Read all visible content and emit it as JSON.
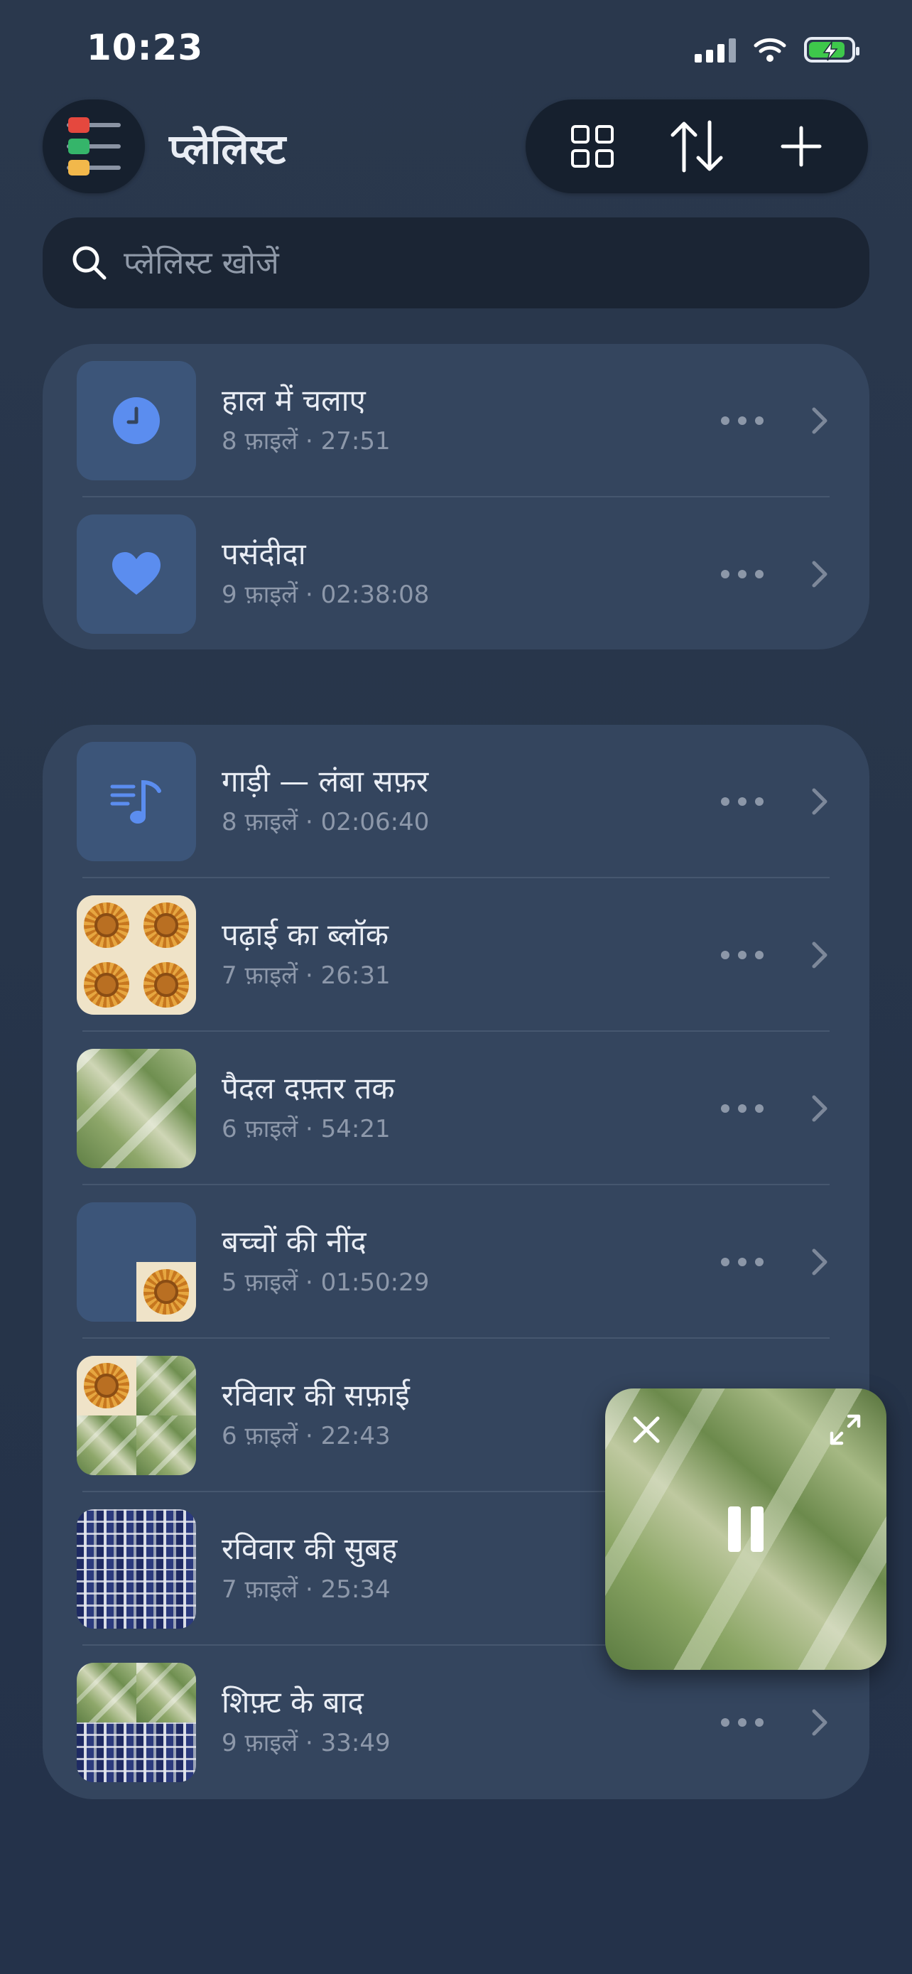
{
  "status_bar": {
    "time": "10:23"
  },
  "header": {
    "title": "प्लेलिस्ट"
  },
  "search": {
    "placeholder": "प्लेलिस्ट खोजें"
  },
  "system_playlists": [
    {
      "title": "हाल में चलाए",
      "meta": "8 फ़ाइलें · 27:51",
      "icon": "clock-icon"
    },
    {
      "title": "पसंदीदा",
      "meta": "9 फ़ाइलें · 02:38:08",
      "icon": "heart-icon"
    }
  ],
  "user_playlists": [
    {
      "title": "गाड़ी — लंबा सफ़र",
      "meta": "8 फ़ाइलें · 02:06:40",
      "icon": "music-list-icon"
    },
    {
      "title": "पढ़ाई का ब्लॉक",
      "meta": "7 फ़ाइलें · 26:31",
      "icon": "playlist-artwork"
    },
    {
      "title": "पैदल दफ़्तर तक",
      "meta": "6 फ़ाइलें · 54:21",
      "icon": "playlist-artwork"
    },
    {
      "title": "बच्चों की नींद",
      "meta": "5 फ़ाइलें · 01:50:29",
      "icon": "playlist-artwork"
    },
    {
      "title": "रविवार की सफ़ाई",
      "meta": "6 फ़ाइलें · 22:43",
      "icon": "playlist-artwork"
    },
    {
      "title": "रविवार की सुबह",
      "meta": "7 फ़ाइलें · 25:34",
      "icon": "playlist-artwork"
    },
    {
      "title": "शिफ़्ट के बाद",
      "meta": "9 फ़ाइलें · 33:49",
      "icon": "playlist-artwork"
    }
  ],
  "colors": {
    "accent": "#5b8def",
    "card": "#34455e",
    "background": "#263449",
    "battery": "#3ec84b"
  },
  "mini_player": {
    "state": "playing"
  }
}
